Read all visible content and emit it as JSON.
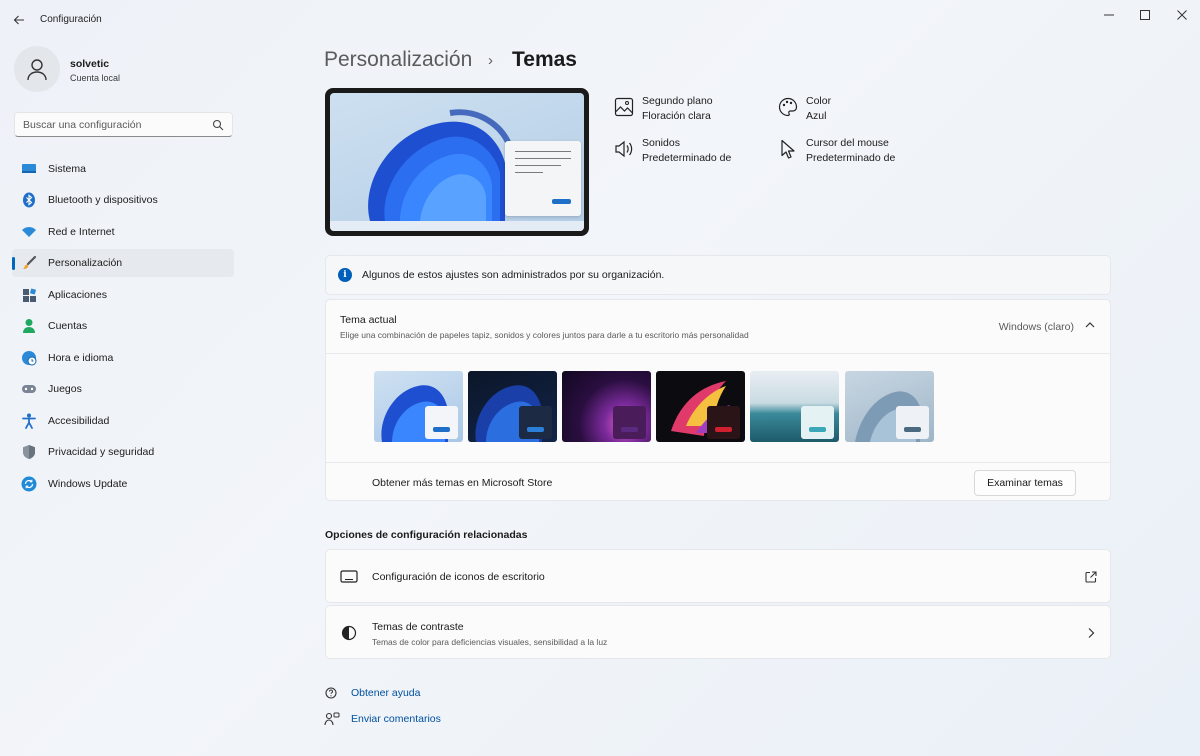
{
  "window": {
    "title": "Configuración"
  },
  "profile": {
    "name": "solvetic",
    "account_type": "Cuenta local"
  },
  "search": {
    "placeholder": "Buscar una configuración"
  },
  "sidebar": {
    "items": [
      {
        "label": "Sistema",
        "icon": "monitor-icon"
      },
      {
        "label": "Bluetooth y dispositivos",
        "icon": "bluetooth-icon"
      },
      {
        "label": "Red e Internet",
        "icon": "wifi-icon"
      },
      {
        "label": "Personalización",
        "icon": "brush-icon",
        "active": true
      },
      {
        "label": "Aplicaciones",
        "icon": "apps-icon"
      },
      {
        "label": "Cuentas",
        "icon": "person-icon"
      },
      {
        "label": "Hora e idioma",
        "icon": "globe-clock-icon"
      },
      {
        "label": "Juegos",
        "icon": "gamepad-icon"
      },
      {
        "label": "Accesibilidad",
        "icon": "accessibility-icon"
      },
      {
        "label": "Privacidad y seguridad",
        "icon": "shield-icon"
      },
      {
        "label": "Windows Update",
        "icon": "update-icon"
      }
    ]
  },
  "breadcrumb": {
    "parent": "Personalización",
    "separator": "›",
    "current": "Temas"
  },
  "properties": {
    "background": {
      "title": "Segundo plano",
      "value": "Floración clara",
      "icon": "image-icon"
    },
    "color": {
      "title": "Color",
      "value": "Azul",
      "icon": "palette-icon"
    },
    "sounds": {
      "title": "Sonidos",
      "value": "Predeterminado de",
      "icon": "speaker-icon"
    },
    "cursor": {
      "title": "Cursor del mouse",
      "value": "Predeterminado de",
      "icon": "cursor-icon"
    }
  },
  "info_bar": {
    "text": "Algunos de estos ajustes son administrados por su organización."
  },
  "current_theme": {
    "title": "Tema actual",
    "description": "Elige una combinación de papeles tapiz, sonidos y colores juntos para darle a tu escritorio más personalidad",
    "value": "Windows (claro)",
    "themes": [
      {
        "name": "windows-light",
        "accent": "#1f6fc8"
      },
      {
        "name": "windows-dark",
        "accent": "#2b7fd8"
      },
      {
        "name": "glow",
        "accent": "#5a2a80"
      },
      {
        "name": "captured-motion",
        "accent": "#d02030"
      },
      {
        "name": "sunrise",
        "accent": "#3aa8b8"
      },
      {
        "name": "flow",
        "accent": "#4a6a80"
      }
    ],
    "store_text": "Obtener más temas en Microsoft Store",
    "browse_button": "Examinar temas"
  },
  "related": {
    "title": "Opciones de configuración relacionadas",
    "items": [
      {
        "title": "Configuración de iconos de escritorio",
        "icon": "desktop-icon",
        "action_icon": "external-link-icon"
      },
      {
        "title": "Temas de contraste",
        "subtitle": "Temas de color para deficiencias visuales, sensibilidad a la luz",
        "icon": "contrast-icon",
        "action_icon": "chevron-right-icon"
      }
    ]
  },
  "footer_links": {
    "help": "Obtener ayuda",
    "feedback": "Enviar comentarios"
  },
  "colors": {
    "accent": "#0067c0",
    "link": "#0050a0"
  }
}
